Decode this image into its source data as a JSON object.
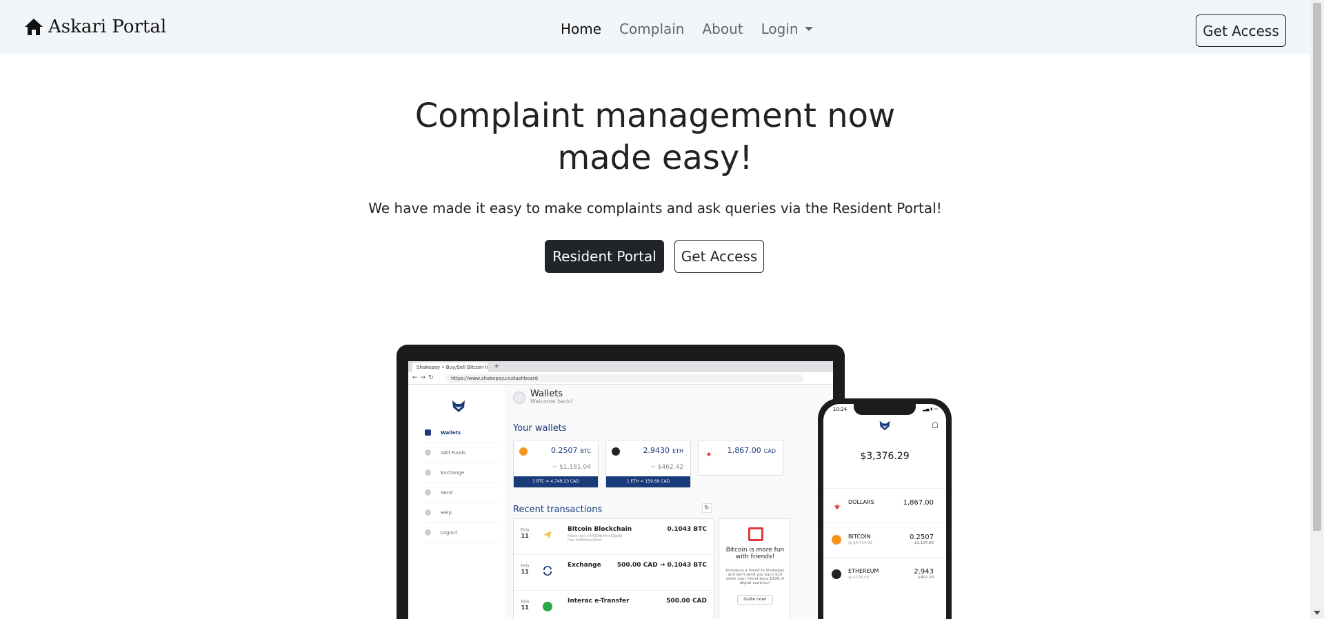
{
  "navbar": {
    "brand": "Askari Portal",
    "links": [
      {
        "label": "Home",
        "active": true
      },
      {
        "label": "Complain"
      },
      {
        "label": "About"
      },
      {
        "label": "Login"
      }
    ],
    "cta": "Get Access"
  },
  "hero": {
    "title": "Complaint management now made easy!",
    "subtitle": "We have made it easy to make complaints and ask queries via the Resident Portal!",
    "primary_button": "Resident Portal",
    "secondary_button": "Get Access"
  },
  "laptop": {
    "tab_title": "Shakepay • Buy/Sell Bitcoin in ...",
    "url": "https://www.shakepay.co/dashboard",
    "sidebar": [
      "Wallets",
      "Add Funds",
      "Exchange",
      "Send",
      "Help",
      "Logout"
    ],
    "header_title": "Wallets",
    "header_sub": "Welcome back!",
    "your_wallets": "Your wallets",
    "wallets": [
      {
        "amount": "0.2507",
        "currency": "BTC",
        "fiat": "~ $1,181.04",
        "rate": "1 BTC = 4,749.23 CAD"
      },
      {
        "amount": "2.9430",
        "currency": "ETH",
        "fiat": "~ $462.42",
        "rate": "1 ETH = 159.69 CAD"
      },
      {
        "amount": "1,867.00",
        "currency": "CAD",
        "fiat": "",
        "rate": ""
      }
    ],
    "recent_transactions": "Recent transactions",
    "transactions": [
      {
        "month": "Feb",
        "day": "11",
        "name": "Bitcoin Blockchain",
        "note": "Notes: bc1 n4rf29dkfrfxc32jp9jf fnrv st35frfnrv2frfvf",
        "amount": "0.1043 BTC"
      },
      {
        "month": "Feb",
        "day": "11",
        "name": "Exchange",
        "note": "",
        "amount": "500.00 CAD → 0.1043 BTC"
      },
      {
        "month": "Feb",
        "day": "11",
        "name": "Interac e-Transfer",
        "note": "",
        "amount": "500.00 CAD"
      }
    ],
    "promo_title": "Bitcoin is more fun with friends!",
    "promo_text": "Introduce a friend to Shakepay and we'll send you each $10 when your friend buys $100 of digital currency!",
    "promo_button": "Invite now!"
  },
  "phone": {
    "time": "10:24",
    "balance": "$3,376.29",
    "rows": [
      {
        "name": "DOLLARS",
        "sub": "",
        "value": "1,867.00",
        "value_sub": ""
      },
      {
        "name": "BITCOIN",
        "sub": "@ $4,414.03",
        "value": "0.2507",
        "value_sub": "$1,107.00"
      },
      {
        "name": "ETHEREUM",
        "sub": "@ $136.00",
        "value": "2.943",
        "value_sub": "$402.29"
      }
    ]
  },
  "colors": {
    "navbar_bg": "#f3f6f9",
    "dark_button": "#212529",
    "app_accent": "#1a3b7a",
    "btc": "#f7931a",
    "eth": "#222222",
    "cad": "#e23a3a"
  },
  "icons": {
    "brand": "home-icon",
    "login_caret": "caret-down-icon"
  }
}
